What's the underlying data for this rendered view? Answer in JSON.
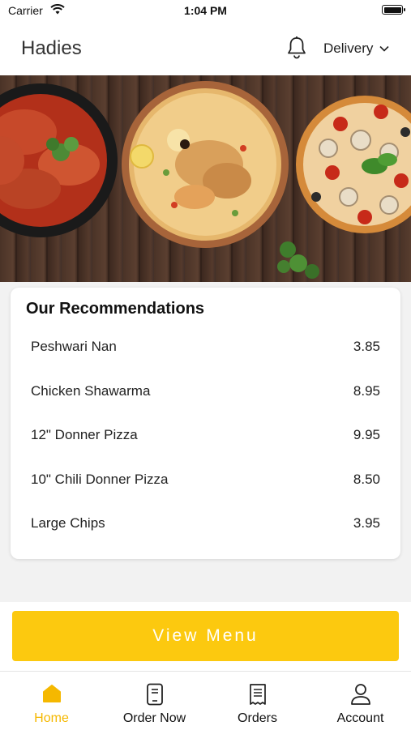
{
  "status_bar": {
    "carrier": "Carrier",
    "time": "1:04 PM"
  },
  "header": {
    "brand": "Hadies",
    "delivery_label": "Delivery"
  },
  "recommendations": {
    "title": "Our Recommendations",
    "items": [
      {
        "name": "Peshwari Nan",
        "price": "3.85"
      },
      {
        "name": "Chicken Shawarma",
        "price": "8.95"
      },
      {
        "name": "12\" Donner  Pizza",
        "price": "9.95"
      },
      {
        "name": "10\" Chili Donner Pizza",
        "price": "8.50"
      },
      {
        "name": "Large Chips",
        "price": "3.95"
      }
    ]
  },
  "view_menu_label": "View Menu",
  "tabs": [
    {
      "label": "Home",
      "icon": "home-icon",
      "active": true
    },
    {
      "label": "Order Now",
      "icon": "phone-order-icon",
      "active": false
    },
    {
      "label": "Orders",
      "icon": "receipt-icon",
      "active": false
    },
    {
      "label": "Account",
      "icon": "user-icon",
      "active": false
    }
  ],
  "colors": {
    "accent": "#fcc90f",
    "active_tab": "#f5b800",
    "background": "#f2f2f2"
  }
}
